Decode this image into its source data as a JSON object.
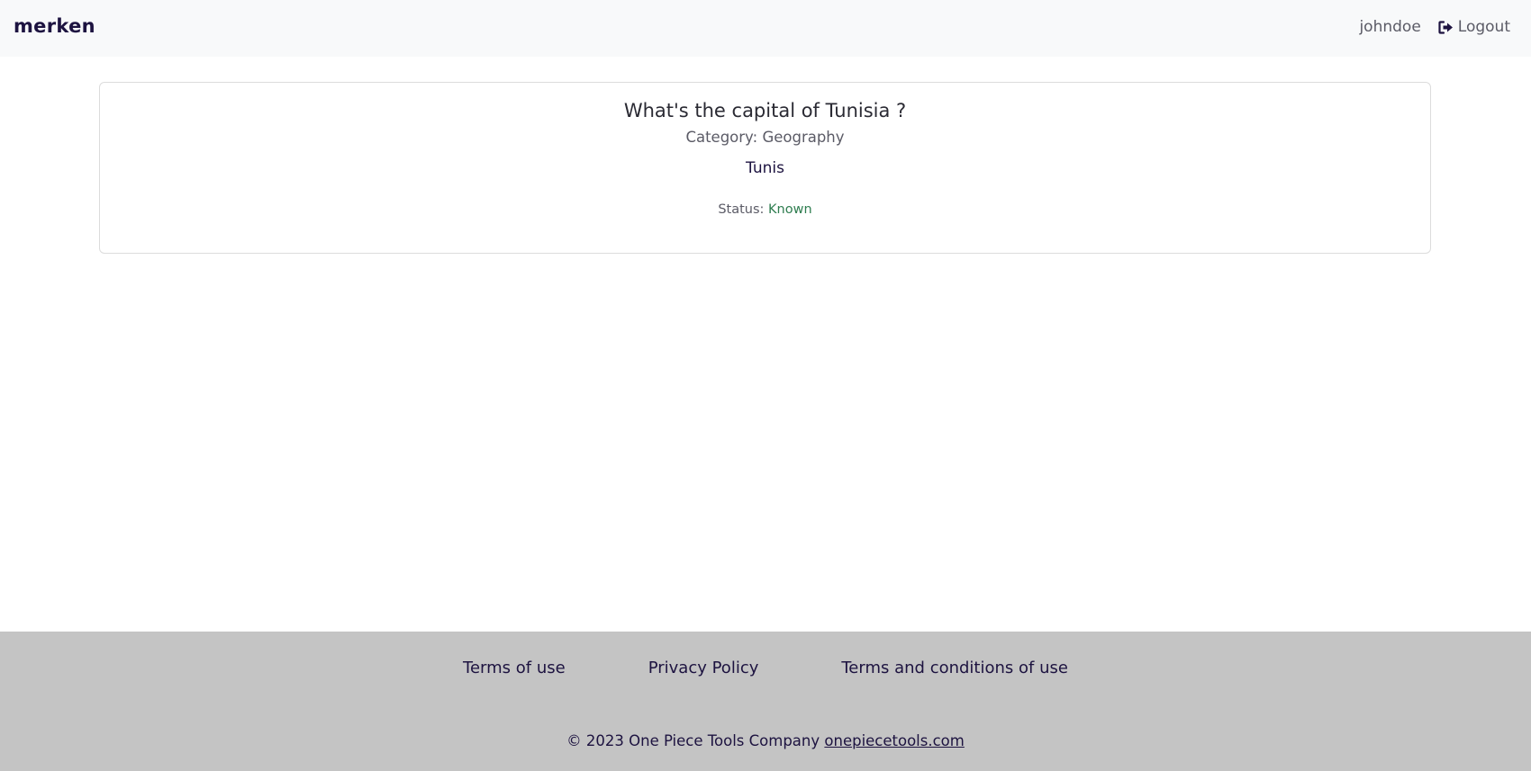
{
  "navbar": {
    "brand": "merken",
    "username": "johndoe",
    "logout_label": "Logout"
  },
  "card": {
    "question": "What's the capital of Tunisia ?",
    "category_prefix": "Category: ",
    "category": "Geography",
    "answer": "Tunis",
    "status_prefix": "Status: ",
    "status": "Known"
  },
  "footer": {
    "links": [
      "Terms of use",
      "Privacy Policy",
      "Terms and conditions of use"
    ],
    "copyright_text": "© 2023 One Piece Tools Company ",
    "company_link": "onepiecetools.com"
  },
  "colors": {
    "brand": "#1d1340",
    "status_known": "#2e7d4f",
    "navbar_bg": "#f8f9fa",
    "footer_bg": "#c4c4c4"
  }
}
